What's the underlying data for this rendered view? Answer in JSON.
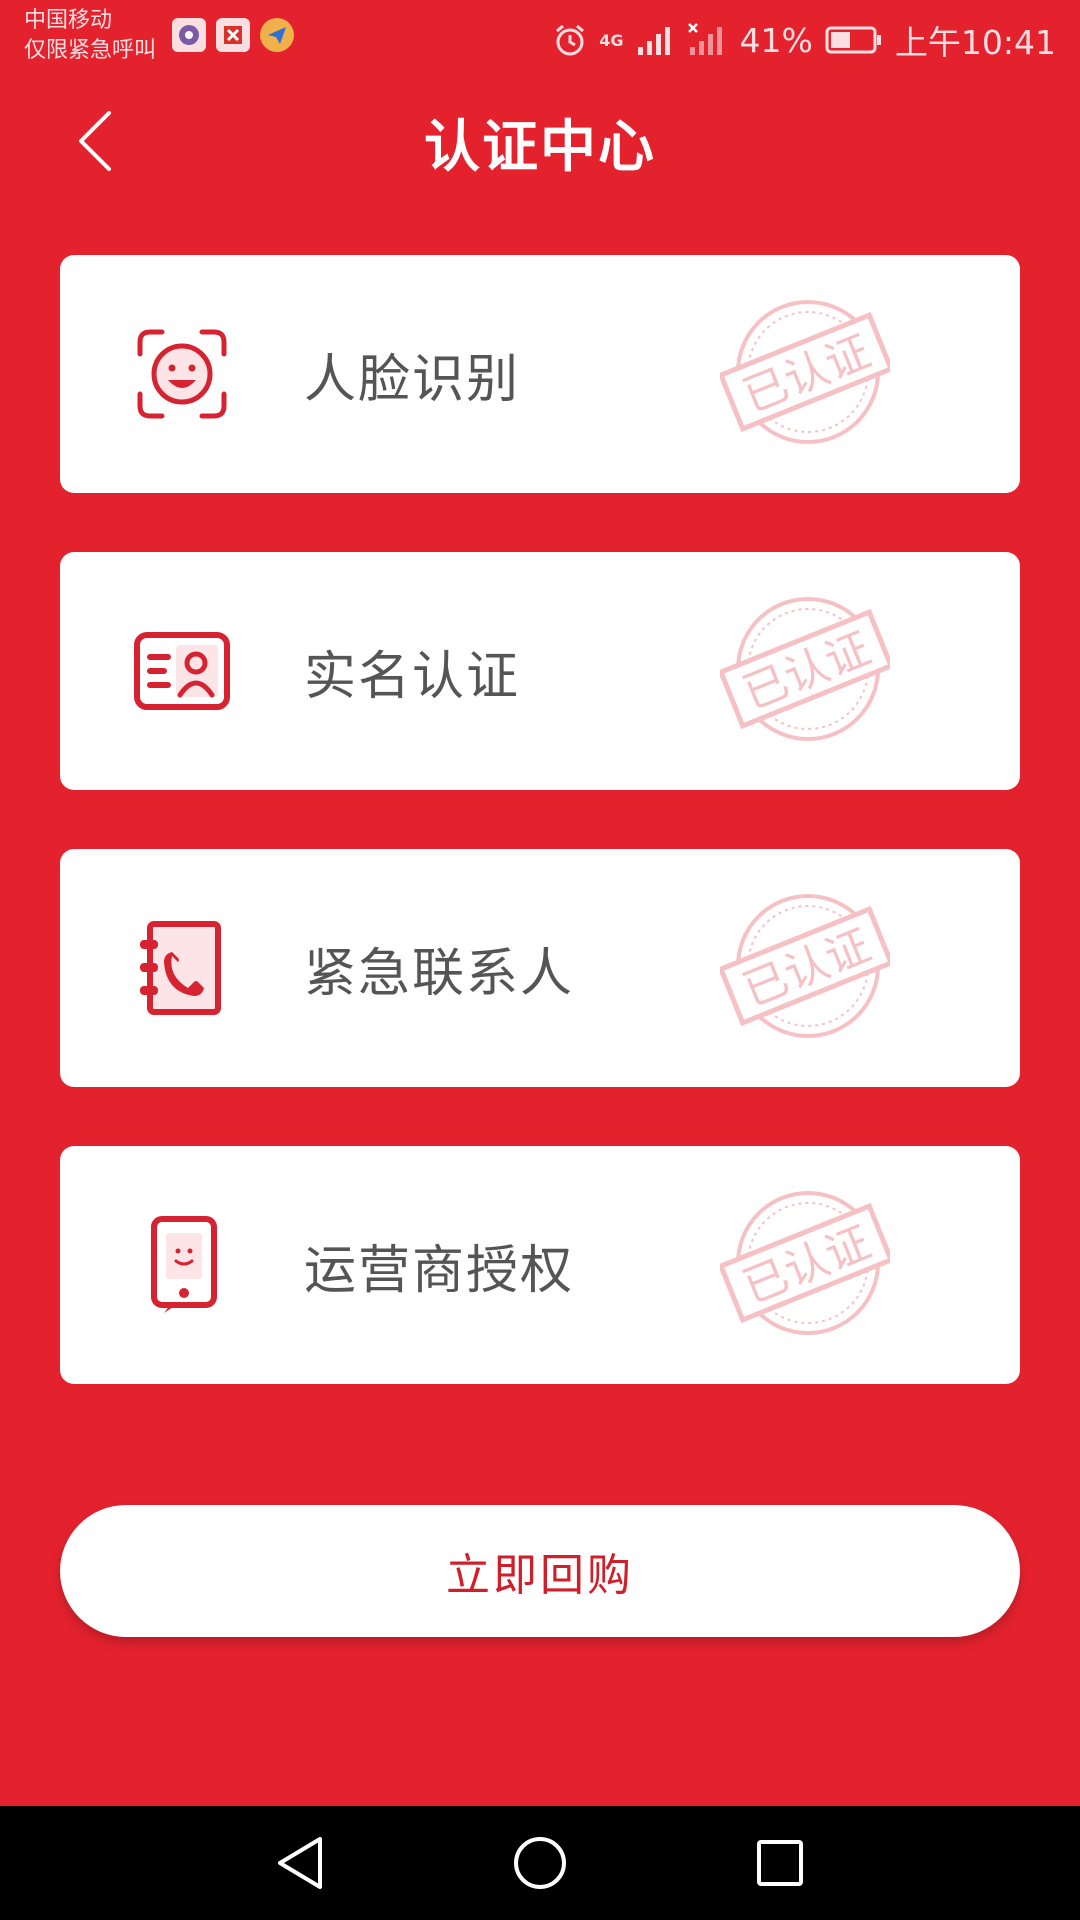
{
  "status_bar": {
    "carrier": "中国移动",
    "carrier_note": "仅限紧急呼叫",
    "network": "4G",
    "battery_percent": "41%",
    "time": "上午10:41"
  },
  "header": {
    "title": "认证中心"
  },
  "cards": [
    {
      "label": "人脸识别",
      "icon": "face-scan-icon",
      "stamp": "已认证"
    },
    {
      "label": "实名认证",
      "icon": "id-card-icon",
      "stamp": "已认证"
    },
    {
      "label": "紧急联系人",
      "icon": "contact-book-phone-icon",
      "stamp": "已认证"
    },
    {
      "label": "运营商授权",
      "icon": "mobile-phone-icon",
      "stamp": "已认证"
    }
  ],
  "action": {
    "repurchase_label": "立即回购"
  },
  "colors": {
    "background": "#e4222e",
    "accent": "#cf1f2a",
    "card": "#ffffff",
    "label_text": "#555555"
  }
}
